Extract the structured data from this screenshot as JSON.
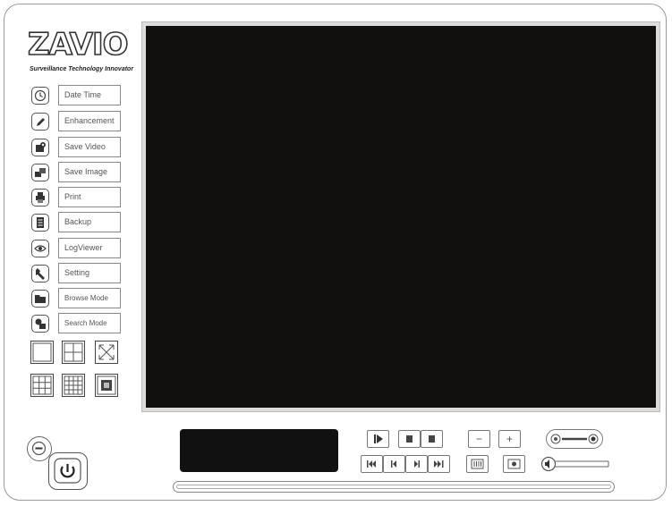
{
  "brand": {
    "logo_text": "ZAVIO",
    "tagline": "Surveillance Technology Innovator"
  },
  "menu": {
    "items": [
      {
        "label": "Date Time",
        "icon": "clock-icon"
      },
      {
        "label": "Enhancement",
        "icon": "pencil-icon"
      },
      {
        "label": "Save Video",
        "icon": "save-video-icon"
      },
      {
        "label": "Save  Image",
        "icon": "save-image-icon"
      },
      {
        "label": "Print",
        "icon": "printer-icon"
      },
      {
        "label": "Backup",
        "icon": "backup-icon"
      },
      {
        "label": "LogViewer",
        "icon": "eye-icon"
      },
      {
        "label": "Setting",
        "icon": "wrench-icon"
      },
      {
        "label": "Browse Mode",
        "icon": "folder-icon"
      },
      {
        "label": "Search Mode",
        "icon": "search-mode-icon"
      }
    ]
  },
  "layout_buttons": [
    "single-view-icon",
    "quad-view-icon",
    "fullscreen-icon",
    "nine-view-icon",
    "sixteen-view-icon",
    "custom-view-icon"
  ],
  "playback_controls": [
    "play-icon",
    "pause-icon",
    "stop-icon",
    "skip-start-icon",
    "step-back-icon",
    "step-forward-icon",
    "skip-end-icon"
  ],
  "zoom_controls": {
    "minus_label": "−",
    "plus_label": "+"
  },
  "colors": {
    "video_background": "#120f0f",
    "display_panel": "#111111"
  }
}
